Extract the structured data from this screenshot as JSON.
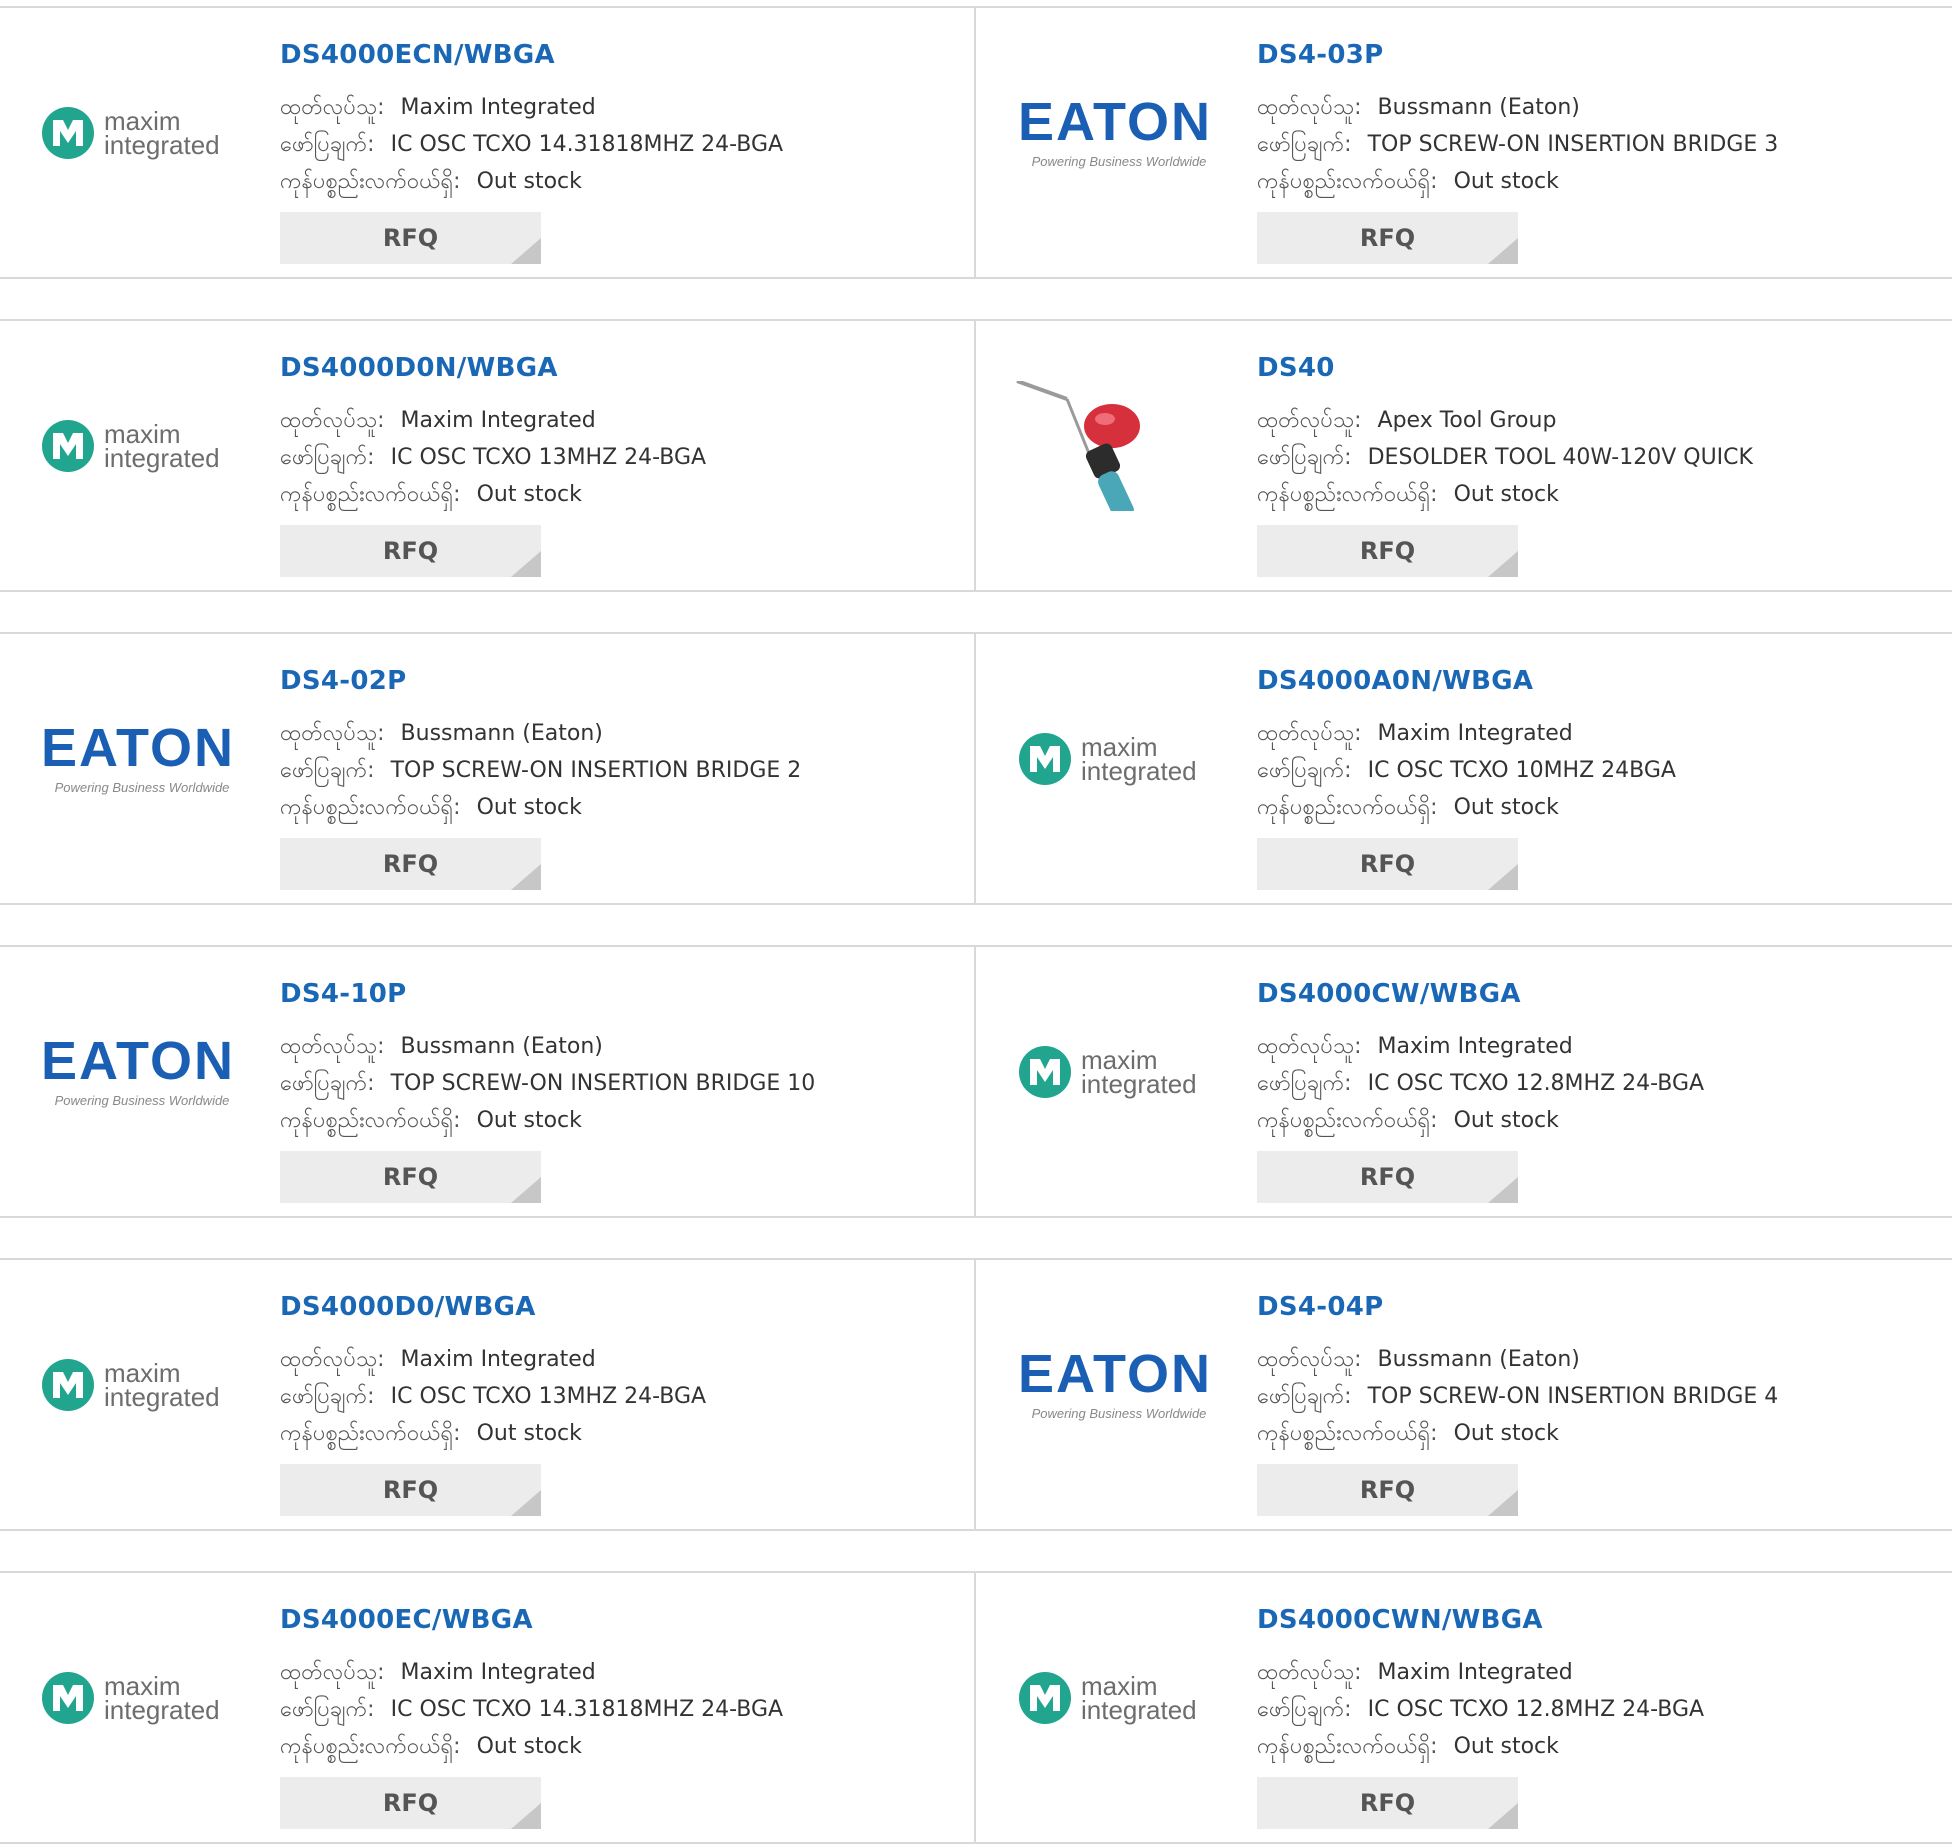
{
  "labels": {
    "manufacturer": "ထုတ်လုပ်သူ:",
    "description": "ဖော်ပြချက်:",
    "stock": "ကုန်ပစ္စည်းလက်ဝယ်ရှိ:",
    "rfq": "RFQ"
  },
  "logos": {
    "maxim": {
      "line1": "maxim",
      "line2": "integrated",
      "color": "#21a58f"
    },
    "eaton": {
      "wordmark": "EATON",
      "tagline": "Powering Business Worldwide",
      "color": "#1a5fb4"
    }
  },
  "colors": {
    "part_link": "#1a68b5",
    "rfq_bg": "#ececec",
    "border": "#d9d9d9"
  },
  "products": [
    {
      "part": "DS4000ECN/WBGA",
      "manufacturer": "Maxim Integrated",
      "description": "IC OSC TCXO 14.31818MHZ 24-BGA",
      "stock": "Out stock",
      "logo": "maxim"
    },
    {
      "part": "DS4-03P",
      "manufacturer": "Bussmann (Eaton)",
      "description": "TOP SCREW-ON INSERTION BRIDGE 3",
      "stock": "Out stock",
      "logo": "eaton"
    },
    {
      "part": "DS4000D0N/WBGA",
      "manufacturer": "Maxim Integrated",
      "description": "IC OSC TCXO 13MHZ 24-BGA",
      "stock": "Out stock",
      "logo": "maxim"
    },
    {
      "part": "DS40",
      "manufacturer": "Apex Tool Group",
      "description": "DESOLDER TOOL 40W-120V QUICK",
      "stock": "Out stock",
      "logo": "tool"
    },
    {
      "part": "DS4-02P",
      "manufacturer": "Bussmann (Eaton)",
      "description": "TOP SCREW-ON INSERTION BRIDGE 2",
      "stock": "Out stock",
      "logo": "eaton"
    },
    {
      "part": "DS4000A0N/WBGA",
      "manufacturer": "Maxim Integrated",
      "description": "IC OSC TCXO 10MHZ 24BGA",
      "stock": "Out stock",
      "logo": "maxim"
    },
    {
      "part": "DS4-10P",
      "manufacturer": "Bussmann (Eaton)",
      "description": "TOP SCREW-ON INSERTION BRIDGE 10",
      "stock": "Out stock",
      "logo": "eaton"
    },
    {
      "part": "DS4000CW/WBGA",
      "manufacturer": "Maxim Integrated",
      "description": "IC OSC TCXO 12.8MHZ 24-BGA",
      "stock": "Out stock",
      "logo": "maxim"
    },
    {
      "part": "DS4000D0/WBGA",
      "manufacturer": "Maxim Integrated",
      "description": "IC OSC TCXO 13MHZ 24-BGA",
      "stock": "Out stock",
      "logo": "maxim"
    },
    {
      "part": "DS4-04P",
      "manufacturer": "Bussmann (Eaton)",
      "description": "TOP SCREW-ON INSERTION BRIDGE 4",
      "stock": "Out stock",
      "logo": "eaton"
    },
    {
      "part": "DS4000EC/WBGA",
      "manufacturer": "Maxim Integrated",
      "description": "IC OSC TCXO 14.31818MHZ 24-BGA",
      "stock": "Out stock",
      "logo": "maxim"
    },
    {
      "part": "DS4000CWN/WBGA",
      "manufacturer": "Maxim Integrated",
      "description": "IC OSC TCXO 12.8MHZ 24-BGA",
      "stock": "Out stock",
      "logo": "maxim"
    }
  ]
}
